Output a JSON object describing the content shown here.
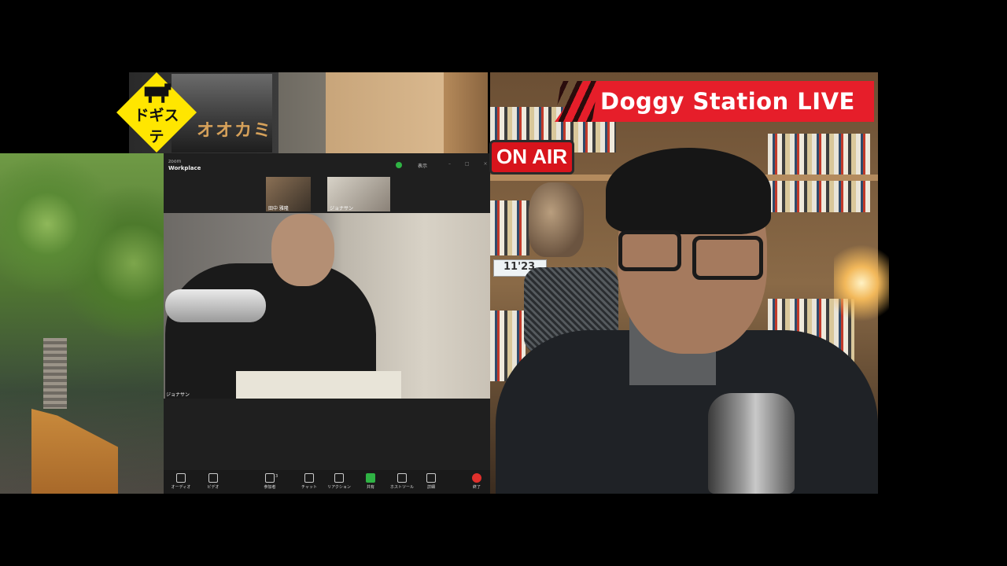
{
  "overlay": {
    "logo_text": "ドギステ",
    "banner_title": "Doggy Station LIVE",
    "on_air": "ON AIR",
    "background_book_title": "オオカミ",
    "clock_time": "11'23"
  },
  "zoom": {
    "app_name": "zoom",
    "meeting_title": "Workplace",
    "view_label": "表示",
    "participants": [
      {
        "name": "田中 雅隆"
      },
      {
        "name": "ジョナサン"
      }
    ],
    "active_speaker_label": "ジョナサン",
    "toolbar": [
      {
        "label": "オーディオ",
        "icon": "microphone-icon"
      },
      {
        "label": "ビデオ",
        "icon": "video-icon"
      },
      {
        "label": "参加者",
        "icon": "participants-icon"
      },
      {
        "label": "チャット",
        "icon": "chat-icon"
      },
      {
        "label": "リアクション",
        "icon": "reaction-icon"
      },
      {
        "label": "共有",
        "icon": "share-icon"
      },
      {
        "label": "ホストツール",
        "icon": "shield-icon"
      },
      {
        "label": "詳細",
        "icon": "more-icon"
      },
      {
        "label": "終了",
        "icon": "end-icon"
      }
    ],
    "participant_count": "3"
  },
  "colors": {
    "banner_red": "#e61e2a",
    "on_air_red": "#d8141c",
    "logo_yellow": "#ffe600",
    "zoom_share_green": "#2fb344",
    "zoom_end_red": "#e0302c"
  }
}
